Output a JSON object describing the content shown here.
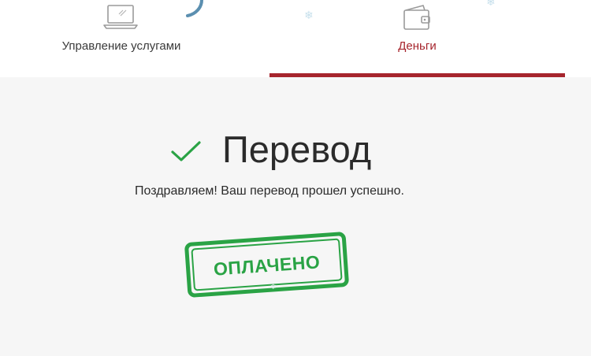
{
  "tabs": [
    {
      "label": "Управление услугами",
      "icon": "laptop-icon",
      "active": false
    },
    {
      "label": "Деньги",
      "icon": "wallet-icon",
      "active": true
    }
  ],
  "main": {
    "title": "Перевод",
    "message": "Поздравляем! Ваш перевод прошел успешно.",
    "stamp": "ОПЛАЧЕНО"
  },
  "colors": {
    "accent": "#a6252d",
    "success": "#2aa345",
    "text": "#2b2b2b",
    "background": "#f6f6f6"
  }
}
